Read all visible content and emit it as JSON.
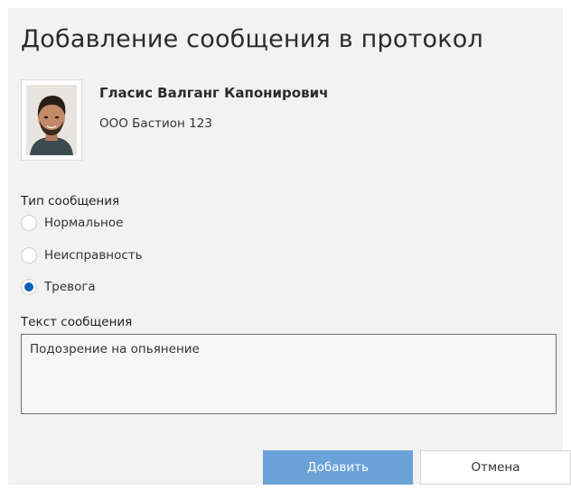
{
  "dialog": {
    "title": "Добавление сообщения в протокол"
  },
  "person": {
    "name": "Гласис Валганг Капонирович",
    "organization": "ООО Бастион 123",
    "photo_icon": "avatar-photo"
  },
  "message_type": {
    "label": "Тип сообщения",
    "options": [
      {
        "label": "Нормальное",
        "checked": false
      },
      {
        "label": "Неисправность",
        "checked": false
      },
      {
        "label": "Тревога",
        "checked": true
      }
    ]
  },
  "message_text": {
    "label": "Текст сообщения",
    "value": "Подозрение на опьянение"
  },
  "buttons": {
    "add_label": "Добавить",
    "cancel_label": "Отмена"
  },
  "colors": {
    "accent": "#0a5fbd",
    "primary_button": "#6aa2d8",
    "dialog_background": "#f2f2f2"
  }
}
